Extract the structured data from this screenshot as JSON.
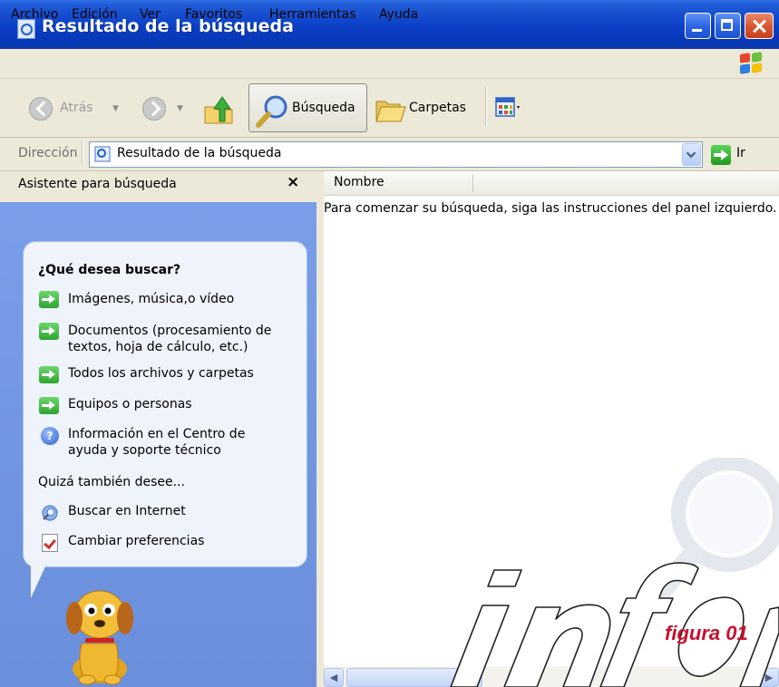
{
  "window": {
    "title": "Resultado de la búsqueda"
  },
  "menu": [
    "Archivo",
    "Edición",
    "Ver",
    "Favoritos",
    "Herramientas",
    "Ayuda"
  ],
  "toolbar": {
    "back_label": "Atrás",
    "search_label": "Búsqueda",
    "folders_label": "Carpetas"
  },
  "address": {
    "label": "Dirección",
    "value": "Resultado de la búsqueda",
    "go_label": "Ir"
  },
  "left_pane": {
    "title": "Asistente para búsqueda",
    "close_label": "×",
    "question": "¿Qué desea buscar?",
    "options": [
      "Imágenes, música,o vídeo",
      "Documentos (procesamiento de",
      "textos, hoja de cálculo, etc.)",
      "Todos los archivos y carpetas",
      "Equipos o personas"
    ],
    "help_option": [
      "Información en el Centro de",
      "ayuda y soporte técnico"
    ],
    "also_label": "Quizá también desee...",
    "also_options": [
      "Buscar en Internet",
      "Cambiar preferencias"
    ]
  },
  "results": {
    "column_name": "Nombre",
    "empty_message": "Para comenzar su búsqueda, siga las instrucciones del panel izquierdo."
  },
  "caption": "figura 01",
  "icons": {
    "window": "search-results-icon",
    "back": "back-arrow-icon",
    "forward": "forward-arrow-icon",
    "up": "folder-up-icon",
    "search": "magnifier-icon",
    "folders": "folders-icon",
    "views": "views-icon",
    "go": "go-arrow-icon",
    "help": "help-icon",
    "internet": "internet-search-icon",
    "preferences": "preferences-icon",
    "assistant": "dog-assistant-icon"
  },
  "colors": {
    "titlebar": "#0a3fc6",
    "left_pane": "#7b9ee9",
    "close_button": "#d9542d",
    "caption": "#c8102e"
  }
}
